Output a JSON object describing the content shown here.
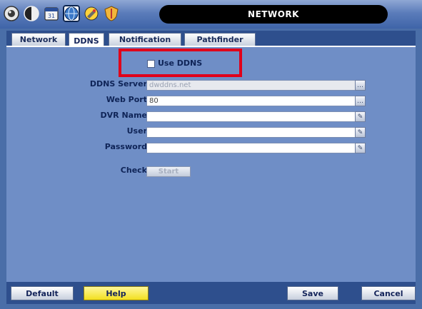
{
  "window": {
    "title": "NETWORK"
  },
  "toolbar": {
    "icons": [
      "camera-icon",
      "display-icon",
      "calendar-icon",
      "network-icon",
      "tools-icon",
      "shield-icon"
    ]
  },
  "tabs": [
    {
      "label": "Network"
    },
    {
      "label": "DDNS",
      "active": true
    },
    {
      "label": "Notification"
    },
    {
      "label": "Pathfinder"
    }
  ],
  "form": {
    "use_ddns_label": "Use DDNS",
    "use_ddns_checked": false,
    "ddns_server": {
      "label": "DDNS Server",
      "value": "dwddns.net"
    },
    "web_port": {
      "label": "Web Port",
      "value": "80"
    },
    "dvr_name": {
      "label": "DVR Name",
      "value": ""
    },
    "user": {
      "label": "User",
      "value": ""
    },
    "password": {
      "label": "Password",
      "value": ""
    },
    "check": {
      "label": "Check",
      "button": "Start"
    }
  },
  "buttons": {
    "default": "Default",
    "help": "Help",
    "save": "Save",
    "cancel": "Cancel"
  },
  "colors": {
    "frame": "#4a6ea8",
    "panel": "#6f8ec6",
    "highlight": "#e0001a",
    "help_button": "#f2df1f"
  }
}
